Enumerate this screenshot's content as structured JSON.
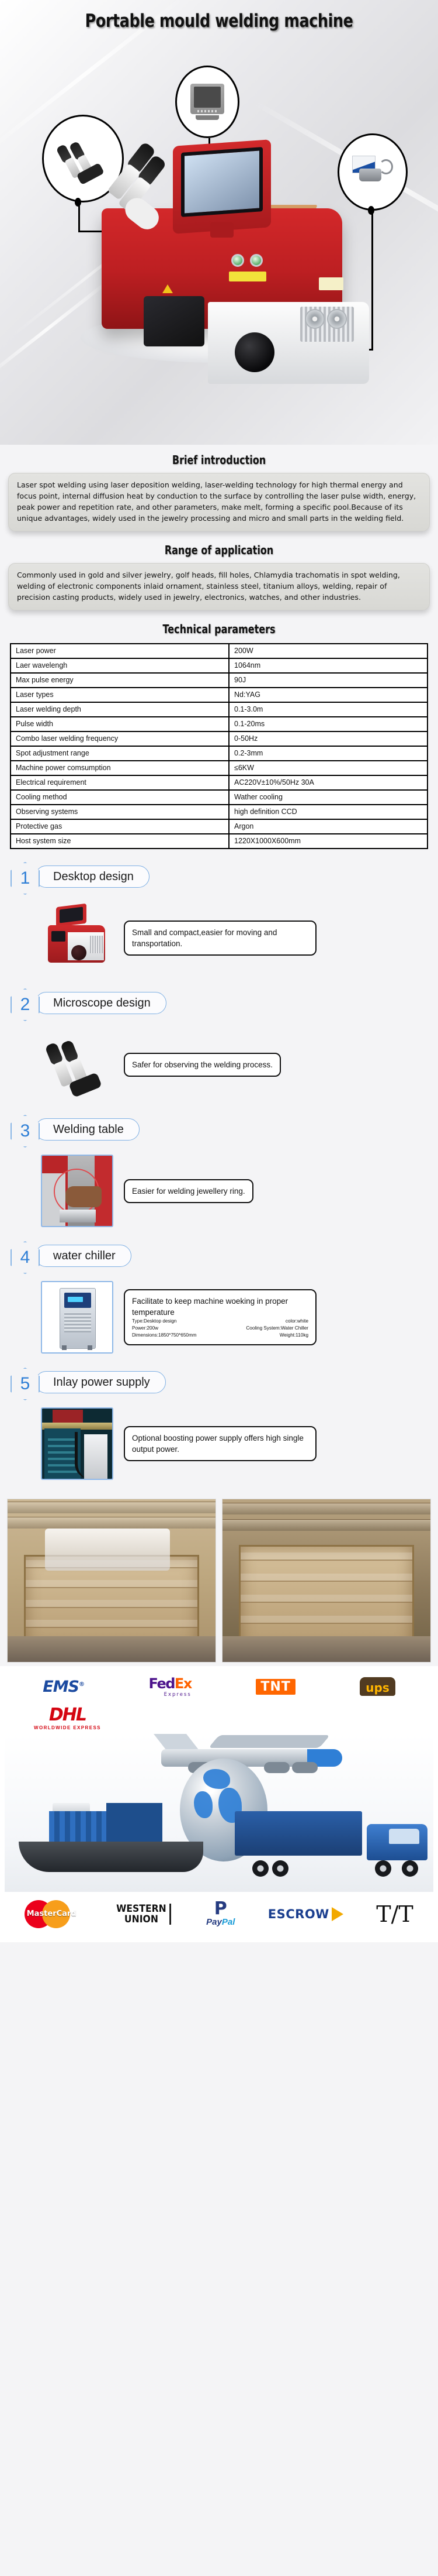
{
  "hero": {
    "title": "Portable mould welding machine",
    "callouts": [
      {
        "name": "monitor-callout",
        "icon": "monitor-icon"
      },
      {
        "name": "microscope-callout",
        "icon": "microscope-icon"
      },
      {
        "name": "foot-switch-callout",
        "icon": "foot-switch-icon"
      }
    ]
  },
  "brief": {
    "heading": "Brief introduction",
    "body": "Laser spot welding using laser deposition welding, laser-welding technology for high thermal energy and focus point, internal diffusion heat by conduction to the surface by controlling the laser pulse width, energy, peak power and repetition rate, and other parameters, make melt, forming a specific pool.Because of its unique advantages, widely used in the jewelry processing and micro and small parts in the welding field."
  },
  "application": {
    "heading": "Range of application",
    "body": "Commonly used in gold and silver jewelry, golf heads, fill holes, Chlamydia trachomatis in spot welding, welding of electronic components inlaid ornament, stainless steel, titanium alloys, welding, repair of precision casting products, widely used in jewelry, electronics, watches, and other industries."
  },
  "technical": {
    "heading": "Technical parameters",
    "rows": [
      {
        "key": "Laser power",
        "value": "200W"
      },
      {
        "key": "Laer wavelengh",
        "value": "1064nm"
      },
      {
        "key": "Max pulse energy",
        "value": "90J"
      },
      {
        "key": "Laser types",
        "value": "Nd:YAG"
      },
      {
        "key": "Laser welding depth",
        "value": "0.1-3.0m"
      },
      {
        "key": "Pulse width",
        "value": "0.1-20ms"
      },
      {
        "key": "Combo laser welding frequency",
        "value": "0-50Hz"
      },
      {
        "key": "Spot adjustment range",
        "value": "0.2-3mm"
      },
      {
        "key": "Machine power comsumption",
        "value": "≤6KW"
      },
      {
        "key": "Electrical requirement",
        "value": "AC220V±10%/50Hz 30A"
      },
      {
        "key": "Cooling method",
        "value": "Wather cooling"
      },
      {
        "key": "Observing systems",
        "value": "high definition CCD"
      },
      {
        "key": "Protective gas",
        "value": "Argon"
      },
      {
        "key": "Host system size",
        "value": "1220X1000X600mm"
      }
    ]
  },
  "features": [
    {
      "num": "1",
      "title": "Desktop design",
      "desc": "Small and compact,easier for moving and transportation.",
      "thumb": "machine-thumbnail"
    },
    {
      "num": "2",
      "title": "Microscope design",
      "desc": "Safer for observing the welding process.",
      "thumb": "microscope-thumbnail"
    },
    {
      "num": "3",
      "title": "Welding table",
      "desc": "Easier for welding jewellery ring.",
      "thumb": "welding-table-thumbnail"
    },
    {
      "num": "4",
      "title": "water chiller",
      "desc": "Facilitate to keep machine woeking in proper temperature",
      "thumb": "water-chiller-thumbnail",
      "mini_specs": [
        {
          "left": "Type:Desktop design",
          "right": "color:white"
        },
        {
          "left": "Power:200w",
          "right": "Cooling System:Water Chiller"
        },
        {
          "left": "Dimensions:1850*750*650mm",
          "right": "Weight:110kg"
        }
      ]
    },
    {
      "num": "5",
      "title": "Inlay power supply",
      "desc": "Optional boosting power supply offers high single output power.",
      "thumb": "power-supply-thumbnail"
    }
  ],
  "packing": {
    "photos": [
      {
        "name": "wooden-crate-open-photo"
      },
      {
        "name": "wooden-crate-empty-photo"
      }
    ]
  },
  "footer": {
    "shipping": [
      {
        "name": "ems-logo",
        "label": "EMS",
        "sup": "®"
      },
      {
        "name": "fedex-logo",
        "label_a": "Fed",
        "label_b": "Ex",
        "sub": "Express"
      },
      {
        "name": "tnt-logo",
        "label": "TNT"
      },
      {
        "name": "ups-logo",
        "label": "ups"
      },
      {
        "name": "dhl-logo",
        "label": "DHL",
        "sub": "WORLDWIDE EXPRESS"
      }
    ],
    "transport_icons": [
      "airplane-icon",
      "globe-icon",
      "cargo-ship-icon",
      "truck-icon"
    ],
    "payments": [
      {
        "name": "mastercard-logo",
        "label": "MasterCard"
      },
      {
        "name": "western-union-logo",
        "line1": "WESTERN",
        "line2": "UNION"
      },
      {
        "name": "paypal-logo",
        "glyph": "P",
        "word_a": "Pay",
        "word_b": "Pal"
      },
      {
        "name": "escrow-logo",
        "label": "ESCROW"
      },
      {
        "name": "tt-logo",
        "label": "T/T"
      }
    ]
  },
  "colors": {
    "accent_blue": "#2f7fd6",
    "machine_red": "#c9282b",
    "dhl_red": "#d40511",
    "fedex_purple": "#4d148c",
    "fedex_orange": "#ff6200"
  }
}
